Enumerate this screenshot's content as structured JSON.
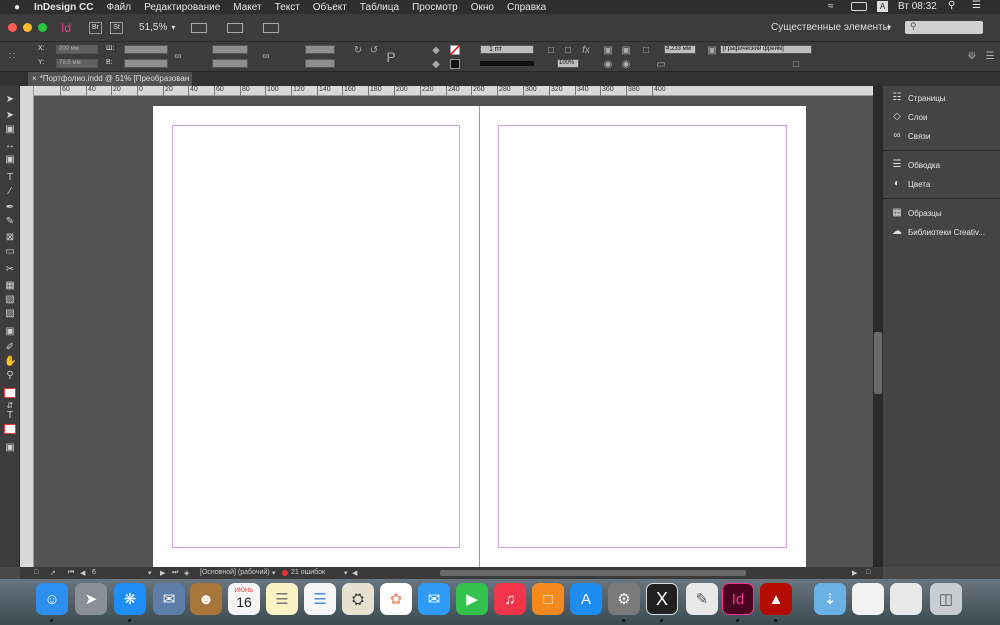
{
  "menubar": {
    "app_name": "InDesign CC",
    "items": [
      "Файл",
      "Редактирование",
      "Макет",
      "Текст",
      "Объект",
      "Таблица",
      "Просмотр",
      "Окно",
      "Справка"
    ],
    "keyboard_layout": "A",
    "clock": "Вт 08:32"
  },
  "appbar": {
    "logo": "Id",
    "bridge": "Br",
    "stock": "St",
    "zoom": "51,5%",
    "workspace": "Существенные элементы"
  },
  "control": {
    "x_label": "X:",
    "y_label": "Y:",
    "w_label": "Ш:",
    "h_label": "В:",
    "x_value": "200 мм",
    "y_value": "79,5 мм",
    "stroke_weight": "1 пт",
    "opacity": "100%",
    "gap": "4,233 мм",
    "object_style": "[Графический фрейм]"
  },
  "document": {
    "tab_title": "*Портфолио.indd @ 51% [Преобразован",
    "ruler_ticks": [
      "60",
      "40",
      "20",
      "0",
      "20",
      "40",
      "60",
      "80",
      "100",
      "120",
      "140",
      "160",
      "180",
      "200",
      "220",
      "240",
      "260",
      "280",
      "300",
      "320",
      "340",
      "360",
      "380",
      "400"
    ]
  },
  "status": {
    "page_number": "6",
    "master": "[Основной] (рабочий)",
    "errors": "21 ошибок"
  },
  "panels": {
    "group1": [
      "Страницы",
      "Слои",
      "Связи"
    ],
    "group2": [
      "Обводка",
      "Цвета"
    ],
    "group3": [
      "Образцы",
      "Библиотеки Creativ..."
    ]
  },
  "dock": {
    "calendar_month": "ИЮНЬ",
    "calendar_day": "16",
    "indesign_label": "Id"
  },
  "colors": {
    "accent_indesign": "#ff3399",
    "margin_guide": "#d49ee0"
  }
}
